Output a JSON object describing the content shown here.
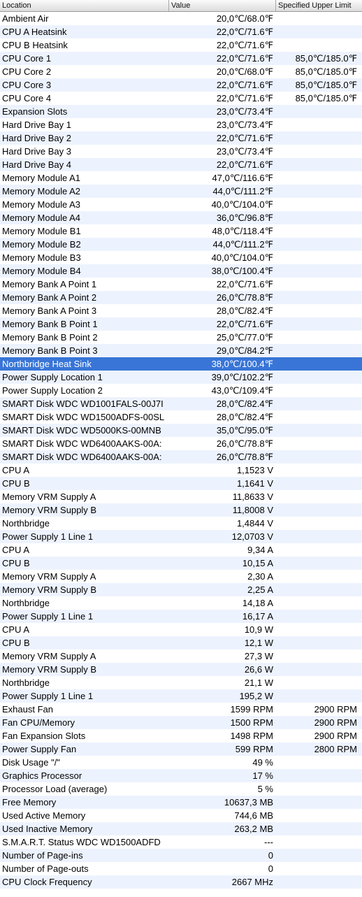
{
  "table": {
    "headers": {
      "location": "Location",
      "value": "Value",
      "limit": "Specified Upper Limit"
    },
    "selected_index": 27,
    "rows": [
      {
        "location": "Ambient Air",
        "value": "20,0℃/68.0℉",
        "limit": ""
      },
      {
        "location": "CPU A Heatsink",
        "value": "22,0℃/71.6℉",
        "limit": ""
      },
      {
        "location": "CPU B Heatsink",
        "value": "22,0℃/71.6℉",
        "limit": ""
      },
      {
        "location": "CPU Core 1",
        "value": "22,0℃/71.6℉",
        "limit": "85,0℃/185.0℉"
      },
      {
        "location": "CPU Core 2",
        "value": "20,0℃/68.0℉",
        "limit": "85,0℃/185.0℉"
      },
      {
        "location": "CPU Core 3",
        "value": "22,0℃/71.6℉",
        "limit": "85,0℃/185.0℉"
      },
      {
        "location": "CPU Core 4",
        "value": "22,0℃/71.6℉",
        "limit": "85,0℃/185.0℉"
      },
      {
        "location": "Expansion Slots",
        "value": "23,0℃/73.4℉",
        "limit": ""
      },
      {
        "location": "Hard Drive Bay 1",
        "value": "23,0℃/73.4℉",
        "limit": ""
      },
      {
        "location": "Hard Drive Bay 2",
        "value": "22,0℃/71.6℉",
        "limit": ""
      },
      {
        "location": "Hard Drive Bay 3",
        "value": "23,0℃/73.4℉",
        "limit": ""
      },
      {
        "location": "Hard Drive Bay 4",
        "value": "22,0℃/71.6℉",
        "limit": ""
      },
      {
        "location": "Memory Module A1",
        "value": "47,0℃/116.6℉",
        "limit": ""
      },
      {
        "location": "Memory Module A2",
        "value": "44,0℃/111.2℉",
        "limit": ""
      },
      {
        "location": "Memory Module A3",
        "value": "40,0℃/104.0℉",
        "limit": ""
      },
      {
        "location": "Memory Module A4",
        "value": "36,0℃/96.8℉",
        "limit": ""
      },
      {
        "location": "Memory Module B1",
        "value": "48,0℃/118.4℉",
        "limit": ""
      },
      {
        "location": "Memory Module B2",
        "value": "44,0℃/111.2℉",
        "limit": ""
      },
      {
        "location": "Memory Module B3",
        "value": "40,0℃/104.0℉",
        "limit": ""
      },
      {
        "location": "Memory Module B4",
        "value": "38,0℃/100.4℉",
        "limit": ""
      },
      {
        "location": "Memory Bank A Point 1",
        "value": "22,0℃/71.6℉",
        "limit": ""
      },
      {
        "location": "Memory Bank A Point 2",
        "value": "26,0℃/78.8℉",
        "limit": ""
      },
      {
        "location": "Memory Bank A Point 3",
        "value": "28,0℃/82.4℉",
        "limit": ""
      },
      {
        "location": "Memory Bank B Point 1",
        "value": "22,0℃/71.6℉",
        "limit": ""
      },
      {
        "location": "Memory Bank B Point 2",
        "value": "25,0℃/77.0℉",
        "limit": ""
      },
      {
        "location": "Memory Bank B Point 3",
        "value": "29,0℃/84.2℉",
        "limit": ""
      },
      {
        "location": "Northbridge Heat Sink",
        "value": "38,0℃/100.4℉",
        "limit": ""
      },
      {
        "location": "Power Supply Location 1",
        "value": "39,0℃/102.2℉",
        "limit": ""
      },
      {
        "location": "Power Supply Location 2",
        "value": "43,0℃/109.4℉",
        "limit": ""
      },
      {
        "location": "SMART Disk WDC WD1001FALS-00J7I",
        "value": "28,0℃/82.4℉",
        "limit": ""
      },
      {
        "location": "SMART Disk WDC WD1500ADFS-00SL",
        "value": "28,0℃/82.4℉",
        "limit": ""
      },
      {
        "location": "SMART Disk WDC WD5000KS-00MNB",
        "value": "35,0℃/95.0℉",
        "limit": ""
      },
      {
        "location": "SMART Disk WDC WD6400AAKS-00A:",
        "value": "26,0℃/78.8℉",
        "limit": ""
      },
      {
        "location": "SMART Disk WDC WD6400AAKS-00A:",
        "value": "26,0℃/78.8℉",
        "limit": ""
      },
      {
        "location": "CPU A",
        "value": "1,1523 V",
        "limit": ""
      },
      {
        "location": "CPU B",
        "value": "1,1641 V",
        "limit": ""
      },
      {
        "location": "Memory VRM Supply A",
        "value": "11,8633 V",
        "limit": ""
      },
      {
        "location": "Memory VRM Supply B",
        "value": "11,8008 V",
        "limit": ""
      },
      {
        "location": "Northbridge",
        "value": "1,4844 V",
        "limit": ""
      },
      {
        "location": "Power Supply 1 Line 1",
        "value": "12,0703 V",
        "limit": ""
      },
      {
        "location": "CPU A",
        "value": "9,34 A",
        "limit": ""
      },
      {
        "location": "CPU B",
        "value": "10,15 A",
        "limit": ""
      },
      {
        "location": "Memory VRM Supply A",
        "value": "2,30 A",
        "limit": ""
      },
      {
        "location": "Memory VRM Supply B",
        "value": "2,25 A",
        "limit": ""
      },
      {
        "location": "Northbridge",
        "value": "14,18 A",
        "limit": ""
      },
      {
        "location": "Power Supply 1 Line 1",
        "value": "16,17 A",
        "limit": ""
      },
      {
        "location": "CPU A",
        "value": "10,9 W",
        "limit": ""
      },
      {
        "location": "CPU B",
        "value": "12,1 W",
        "limit": ""
      },
      {
        "location": "Memory VRM Supply A",
        "value": "27,3 W",
        "limit": ""
      },
      {
        "location": "Memory VRM Supply B",
        "value": "26,6 W",
        "limit": ""
      },
      {
        "location": "Northbridge",
        "value": "21,1 W",
        "limit": ""
      },
      {
        "location": "Power Supply 1 Line 1",
        "value": "195,2 W",
        "limit": ""
      },
      {
        "location": "Exhaust Fan",
        "value": "1599 RPM",
        "limit": "2900 RPM"
      },
      {
        "location": "Fan CPU/Memory",
        "value": "1500 RPM",
        "limit": "2900 RPM"
      },
      {
        "location": "Fan Expansion Slots",
        "value": "1498 RPM",
        "limit": "2900 RPM"
      },
      {
        "location": "Power Supply Fan",
        "value": "599 RPM",
        "limit": "2800 RPM"
      },
      {
        "location": "Disk Usage \"/\"",
        "value": "49 %",
        "limit": ""
      },
      {
        "location": "Graphics Processor",
        "value": "17 %",
        "limit": ""
      },
      {
        "location": "Processor Load (average)",
        "value": "5 %",
        "limit": ""
      },
      {
        "location": "Free Memory",
        "value": "10637,3 MB",
        "limit": ""
      },
      {
        "location": "Used Active Memory",
        "value": "744,6 MB",
        "limit": ""
      },
      {
        "location": "Used Inactive Memory",
        "value": "263,2 MB",
        "limit": ""
      },
      {
        "location": "S.M.A.R.T. Status WDC WD1500ADFD",
        "value": "---",
        "limit": ""
      },
      {
        "location": "Number of Page-ins",
        "value": "0",
        "limit": ""
      },
      {
        "location": "Number of Page-outs",
        "value": "0",
        "limit": ""
      },
      {
        "location": "CPU Clock Frequency",
        "value": "2667 MHz",
        "limit": ""
      }
    ]
  }
}
